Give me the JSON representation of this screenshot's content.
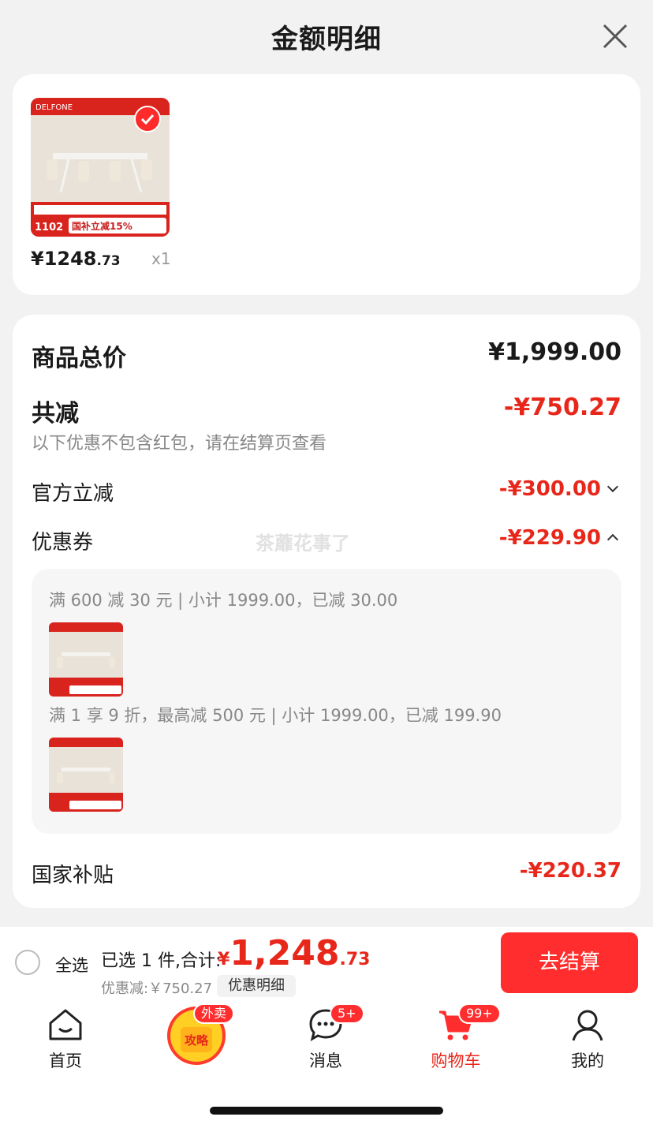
{
  "header": {
    "title": "金额明细"
  },
  "product": {
    "brand": "DELFONE",
    "price_int": "¥1248",
    "price_dec": ".73",
    "qty": "x1",
    "img_price": "1102",
    "img_banner": "国补立减15%"
  },
  "summary": {
    "total_label": "商品总价",
    "total_value": "¥1,999.00",
    "reduce_label": "共减",
    "reduce_value": "-¥750.27",
    "note": "以下优惠不包含红包，请在结算页查看",
    "official_label": "官方立减",
    "official_value": "-¥300.00",
    "coupon_label": "优惠券",
    "coupon_value": "-¥229.90",
    "watermark": "茶蘼花事了",
    "coupon_lines": [
      "满 600 减 30 元 | 小计 1999.00，已减 30.00",
      "满 1 享 9 折，最高减 500 元 | 小计 1999.00，已减 199.90"
    ],
    "subsidy_label": "国家补贴",
    "subsidy_value": "-¥220.37"
  },
  "bottom": {
    "select_all": "全选",
    "selected": "已选 1 件,合计:",
    "currency": "¥",
    "total_int": "1,248",
    "total_dec": ".73",
    "discount": "优惠减:￥750.27",
    "detail_button": "优惠明细",
    "checkout_button": "去结算"
  },
  "tabs": {
    "home": "首页",
    "center_badge": "外卖",
    "center_label": "攻略",
    "messages": "消息",
    "messages_badge": "5+",
    "cart": "购物车",
    "cart_badge": "99+",
    "mine": "我的"
  },
  "colors": {
    "accent": "#e8271b",
    "button": "#ff2d2d"
  }
}
